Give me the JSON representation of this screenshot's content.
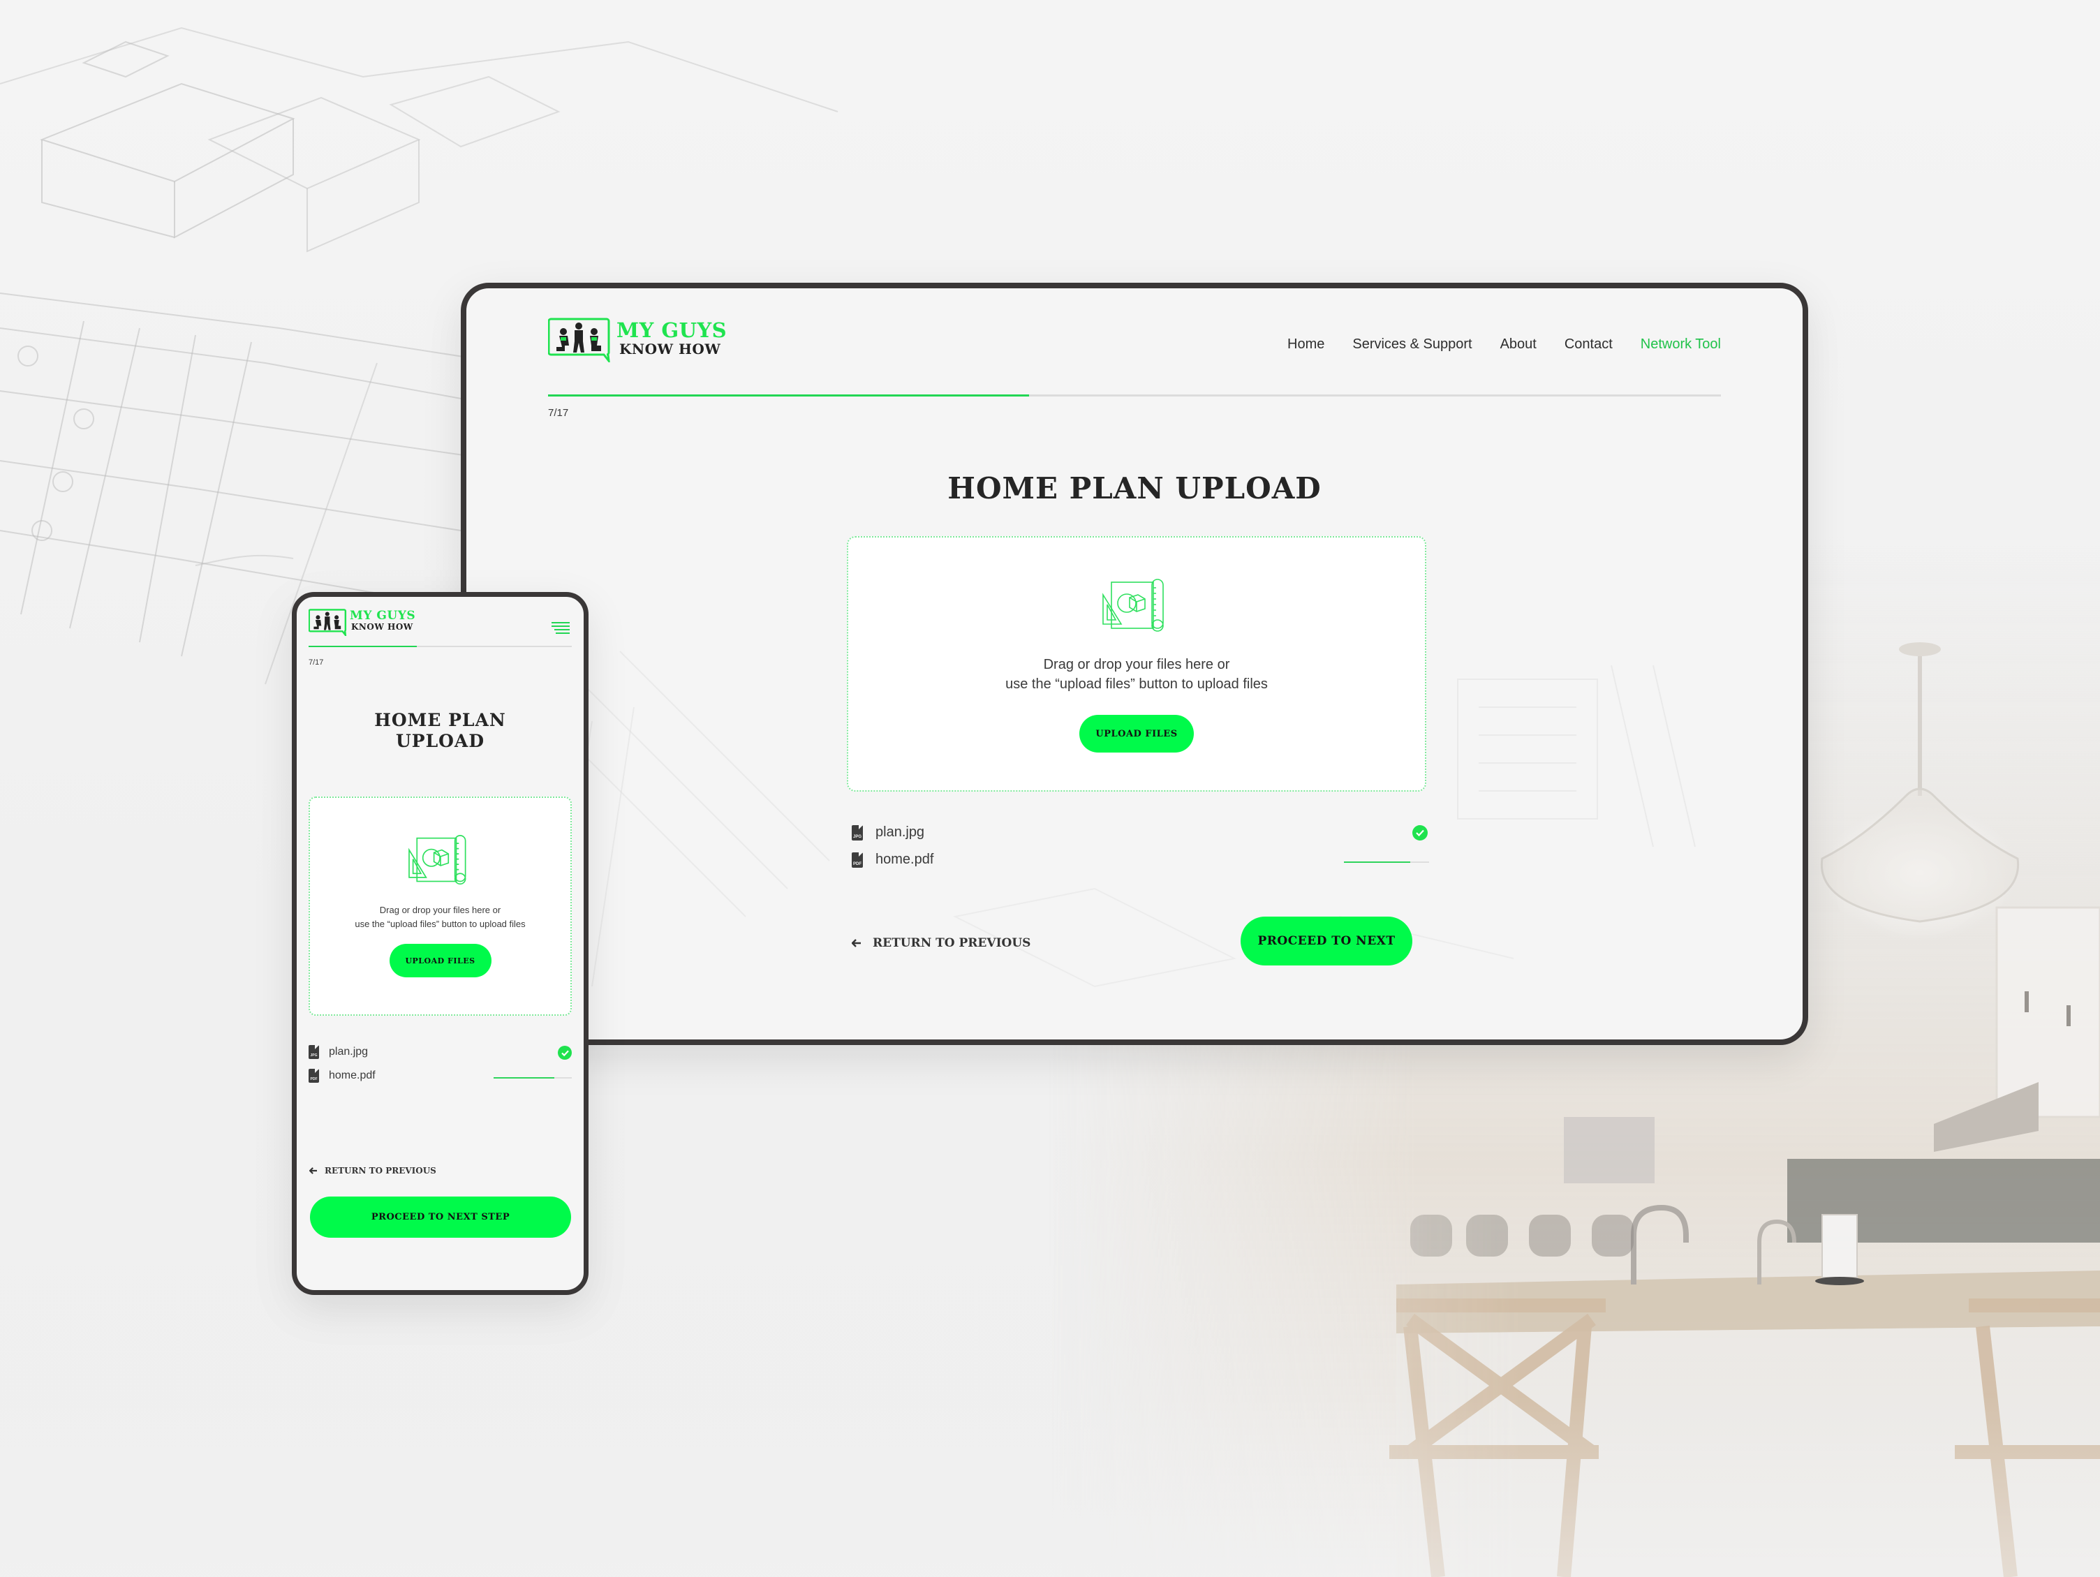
{
  "brand": {
    "line1": "MY GUYS",
    "line2": "KNOW HOW",
    "accent": "#00fa4a",
    "accent_text": "#20c24a"
  },
  "nav": {
    "items": [
      {
        "label": "Home",
        "active": false
      },
      {
        "label": "Services & Support",
        "active": false
      },
      {
        "label": "About",
        "active": false
      },
      {
        "label": "Contact",
        "active": false
      },
      {
        "label": "Network Tool",
        "active": true
      }
    ]
  },
  "progress": {
    "current": 7,
    "total": 17,
    "label": "7/17",
    "fraction": 0.41
  },
  "desktop": {
    "title": "HOME PLAN UPLOAD",
    "dropzone": {
      "line1": "Drag or drop your files here or",
      "line2": "use the “upload files” button to upload files",
      "button": "UPLOAD FILES",
      "icon": "blueprint-icon"
    },
    "files": [
      {
        "name": "plan.jpg",
        "type": "JPG",
        "status": "complete"
      },
      {
        "name": "home.pdf",
        "type": "PDF",
        "status": "uploading",
        "progress": 0.78
      }
    ],
    "return_label": "RETURN TO PREVIOUS",
    "proceed_label": "PROCEED TO NEXT"
  },
  "mobile": {
    "title_line1": "HOME PLAN",
    "title_line2": "UPLOAD",
    "dropzone": {
      "line1": "Drag or drop your files here or",
      "line2": "use the “upload files” button to upload files",
      "button": "UPLOAD FILES"
    },
    "files": [
      {
        "name": "plan.jpg",
        "type": "JPG",
        "status": "complete"
      },
      {
        "name": "home.pdf",
        "type": "PDF",
        "status": "uploading",
        "progress": 0.78
      }
    ],
    "return_label": "RETURN TO PREVIOUS",
    "proceed_label": "PROCEED TO NEXT STEP",
    "menu_icon": "hamburger-menu-icon",
    "progress_fraction": 0.41
  }
}
